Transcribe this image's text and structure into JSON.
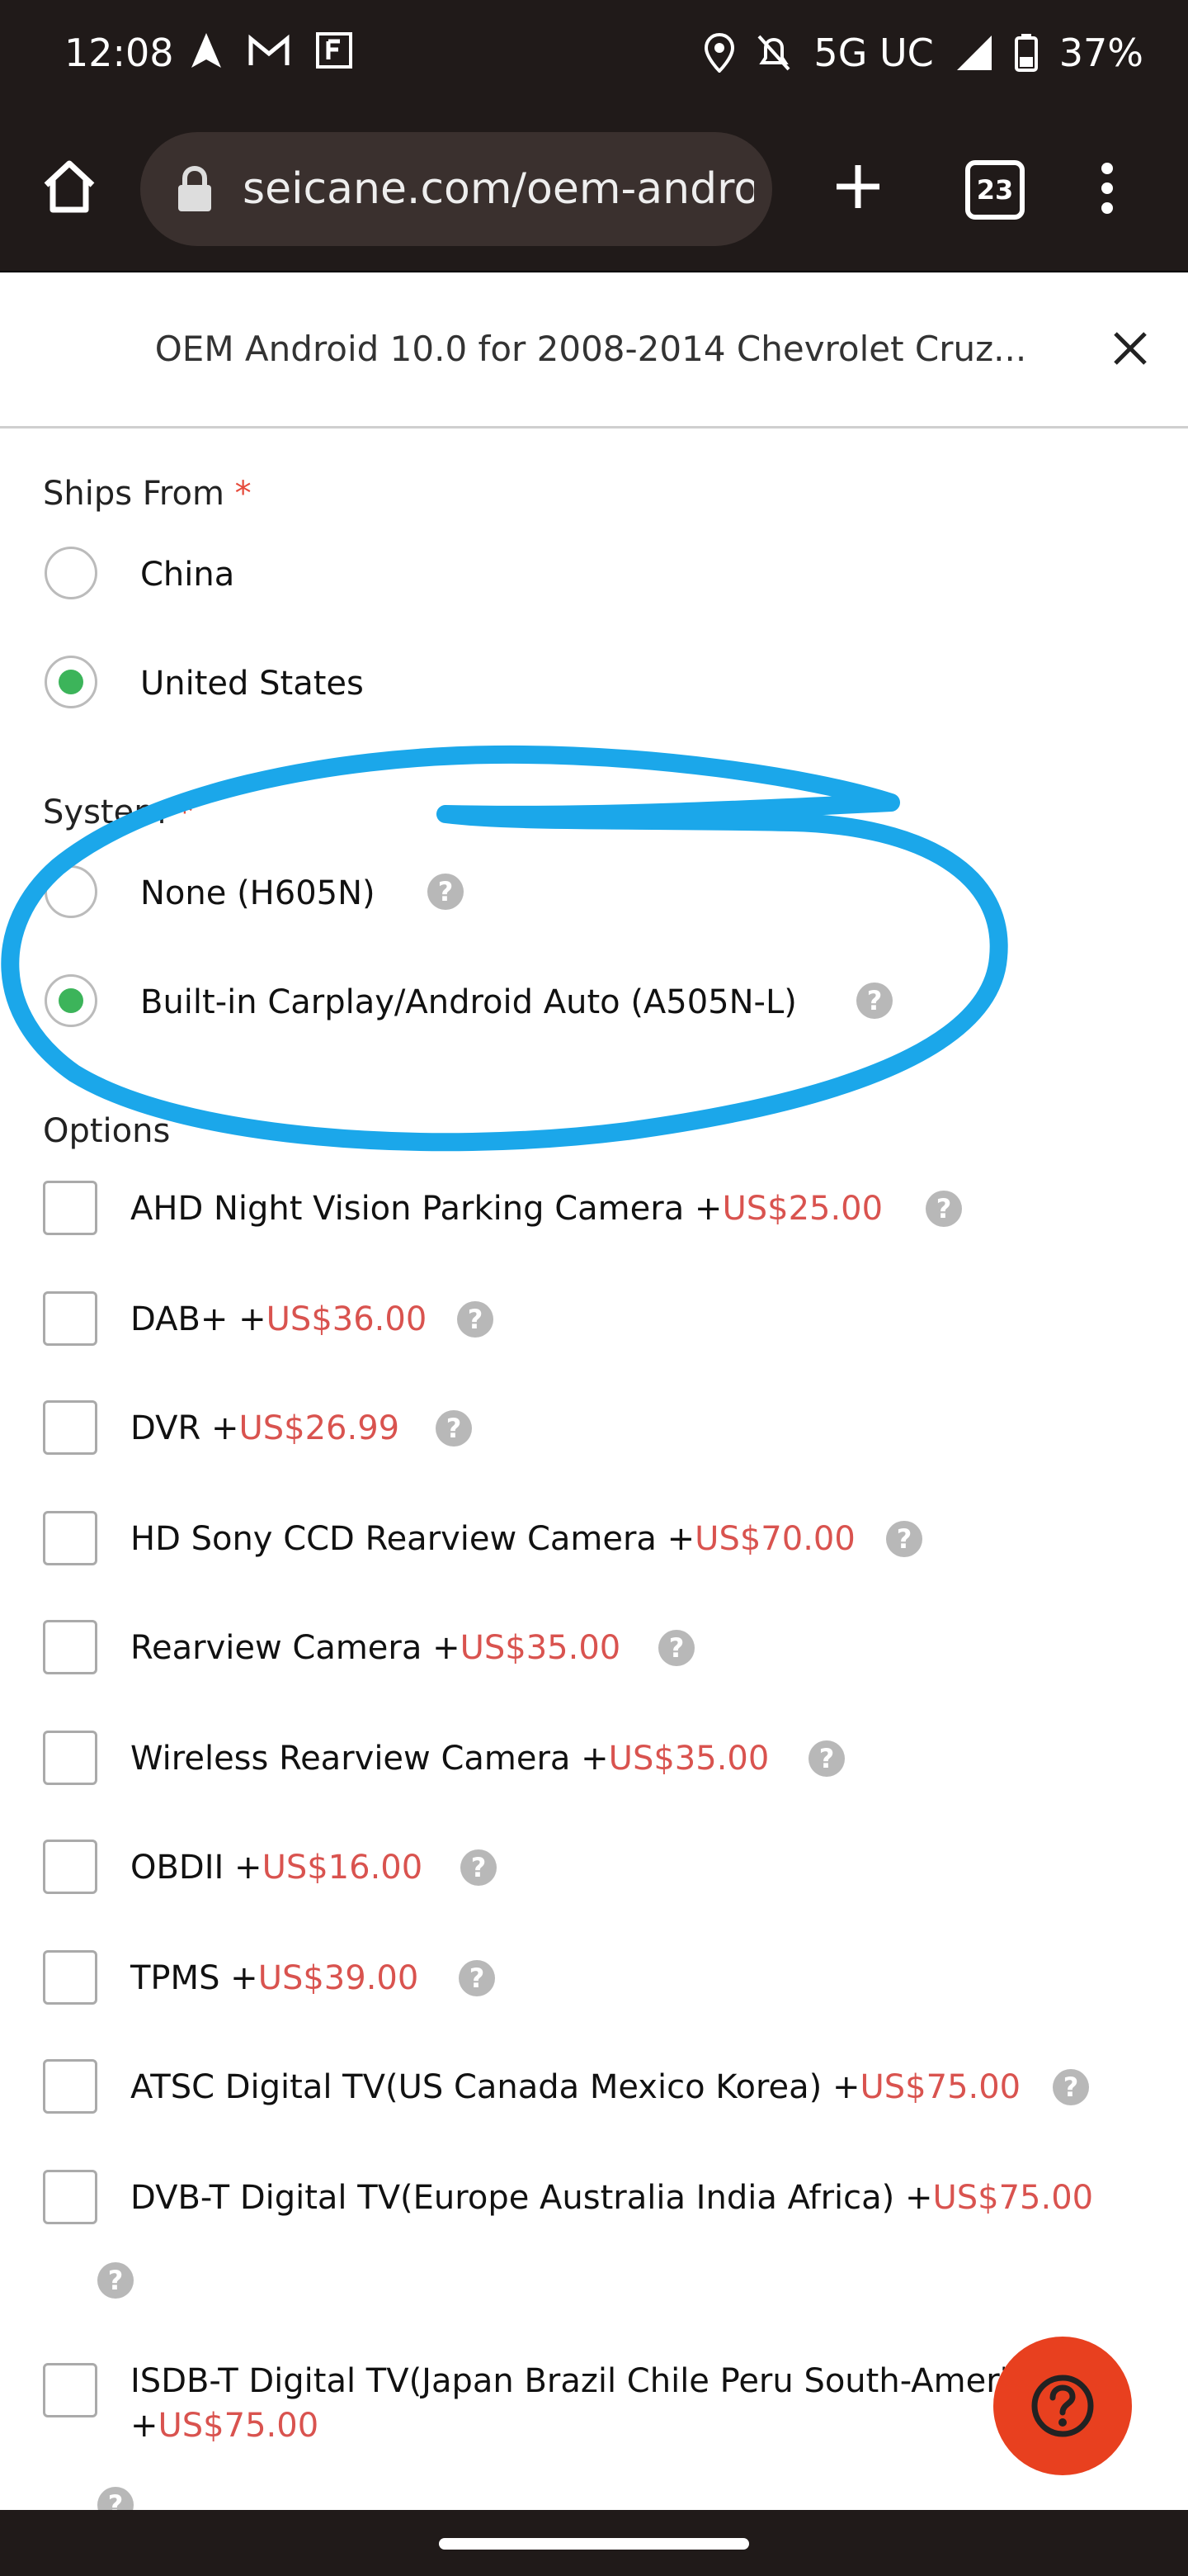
{
  "status_bar": {
    "time": "12:08",
    "network": "5G UC",
    "battery": "37%",
    "icons": [
      "navigation-icon",
      "gmail-icon",
      "f-app-icon",
      "location-icon",
      "mute-bell-icon",
      "signal-icon",
      "battery-icon"
    ]
  },
  "browser": {
    "url": "seicane.com/oem-andro",
    "tab_count": "23"
  },
  "modal": {
    "title": "OEM Android 10.0 for 2008-2014 Chevrolet Cruz..."
  },
  "ships_from": {
    "label": "Ships From",
    "required": "*",
    "options": [
      {
        "label": "China",
        "selected": false
      },
      {
        "label": "United States",
        "selected": true
      }
    ]
  },
  "system": {
    "label": "System",
    "required": "*",
    "options": [
      {
        "label": "None (H605N)",
        "selected": false
      },
      {
        "label": "Built-in Carplay/Android Auto (A505N-L)",
        "selected": true
      }
    ]
  },
  "options": {
    "label": "Options",
    "items": [
      {
        "name": "AHD Night Vision Parking Camera +",
        "price": "US$25.00"
      },
      {
        "name": "DAB+ +",
        "price": "US$36.00"
      },
      {
        "name": "DVR +",
        "price": "US$26.99"
      },
      {
        "name": "HD Sony CCD Rearview Camera +",
        "price": "US$70.00"
      },
      {
        "name": "Rearview Camera +",
        "price": "US$35.00"
      },
      {
        "name": "Wireless Rearview Camera +",
        "price": "US$35.00"
      },
      {
        "name": "OBDII +",
        "price": "US$16.00"
      },
      {
        "name": "TPMS +",
        "price": "US$39.00"
      },
      {
        "name": "ATSC Digital TV(US Canada Mexico Korea) +",
        "price": "US$75.00"
      },
      {
        "name": "DVB-T Digital TV(Europe Australia India Africa) +",
        "price": "US$75.00"
      },
      {
        "name": "ISDB-T Digital TV(Japan Brazil Chile Peru South-America)",
        "price_prefix": "+",
        "price": "US$75.00"
      }
    ]
  },
  "help_glyph": "?",
  "colors": {
    "accent_price": "#d9534f",
    "radio_selected": "#3cb45a",
    "fab": "#e8401f",
    "annotation_circle": "#1ba7ea",
    "chrome_dark": "#201a19"
  }
}
